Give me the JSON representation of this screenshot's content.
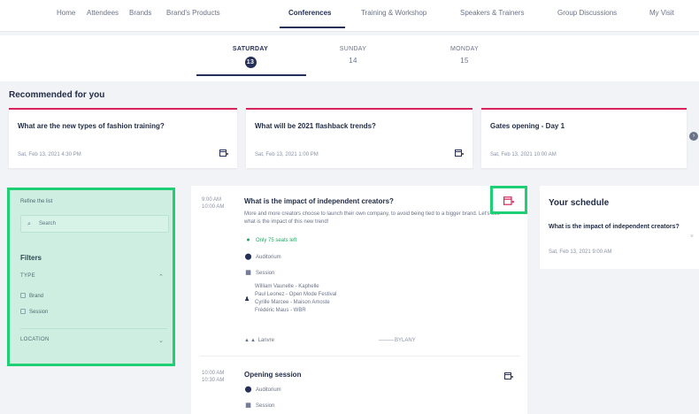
{
  "nav": {
    "items": [
      "Home",
      "Attendees",
      "Brands",
      "Brand's Products",
      "Conferences",
      "Training & Workshop",
      "Speakers & Trainers",
      "Group Discussions",
      "My Visit"
    ],
    "active_index": 4
  },
  "days": [
    {
      "name": "SATURDAY",
      "num": "13"
    },
    {
      "name": "SUNDAY",
      "num": "14"
    },
    {
      "name": "MONDAY",
      "num": "15"
    }
  ],
  "recommended": {
    "title": "Recommended for you",
    "cards": [
      {
        "question": "What are the new types of fashion training?",
        "date": "Sat, Feb 13, 2021 4:30 PM"
      },
      {
        "question": "What will be 2021 flashback trends?",
        "date": "Sat, Feb 13, 2021 1:00 PM"
      },
      {
        "question": "Gates opening - Day 1",
        "date": "Sat, Feb 13, 2021 10:00 AM"
      }
    ]
  },
  "filter": {
    "refine_label": "Refine the list",
    "search_placeholder": "Search",
    "filters_label": "Filters",
    "type_label": "TYPE",
    "options": [
      "Brand",
      "Session"
    ],
    "location_label": "LOCATION"
  },
  "events": [
    {
      "time_start": "9:00 AM",
      "time_end": "10:00 AM",
      "title": "What is the impact of independent creators?",
      "description": "More and more creators choose to launch their own company, to avoid being tied to a bigger brand. Let's see what is the impact of this new trend!",
      "seats": "Only 75 seats left",
      "location": "Auditorium",
      "type": "Session",
      "speakers": [
        "William Vaunelle - Kaphelle",
        "Paul Leonez - Open Mode Festival",
        "Cyrille Marcee - Maison Amoste",
        "Frédéric Maus - WBR"
      ],
      "footer_left": "Lanvre",
      "footer_right": "BYLANY"
    },
    {
      "time_start": "10:00 AM",
      "time_end": "10:30 AM",
      "title": "Opening session",
      "location": "Auditorium",
      "type": "Session"
    }
  ],
  "schedule": {
    "title": "Your schedule",
    "item_title": "What is the impact of independent creators?",
    "item_date": "Sat, Feb 13, 2021 9:00 AM"
  },
  "colors": {
    "accent_navy": "#25305a",
    "accent_pink": "#d8245a",
    "highlight_green": "#1fcf73"
  },
  "icons": {
    "calendar": "calendar-add-icon",
    "search": "search-icon",
    "location": "location-pin-icon",
    "type": "session-type-icon",
    "speakers": "speakers-icon",
    "seats": "seats-dot-icon"
  }
}
